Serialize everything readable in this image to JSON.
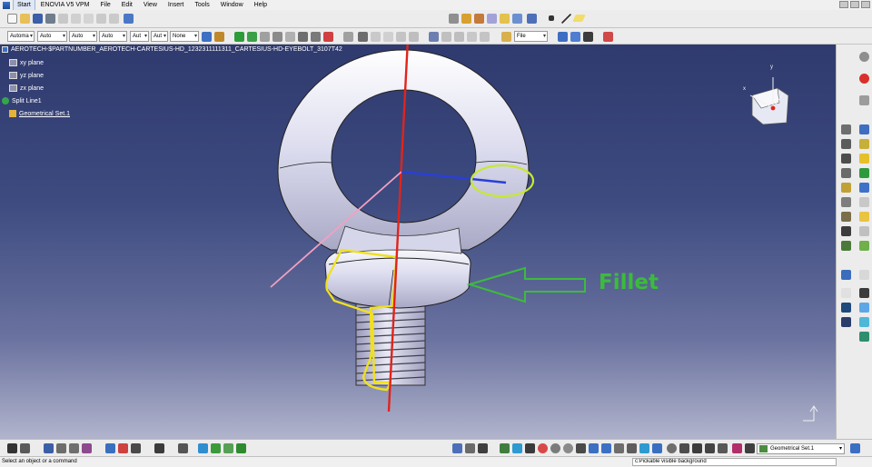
{
  "menubar": {
    "items": [
      "Start",
      "ENOVIA V5 VPM",
      "File",
      "Edit",
      "View",
      "Insert",
      "Tools",
      "Window",
      "Help"
    ]
  },
  "toolbar2": {
    "dropdowns": [
      "Automa",
      "Auto",
      "Auto",
      "Auto",
      "Aut",
      "Aut",
      "None"
    ],
    "file_dropdown": "File"
  },
  "tree": {
    "root": "AEROTECH-$PARTNUMBER_AEROTECH-CARTESIUS-HD_1232311111311_CARTESIUS-HD-EYEBOLT_3107T42",
    "items": [
      "xy plane",
      "yz plane",
      "zx plane",
      "Split Line1",
      "Geometrical Set.1"
    ]
  },
  "annotation": {
    "label": "Fillet",
    "color": "#3cbb3c"
  },
  "compass": {
    "x_label": "x",
    "y_label": "y"
  },
  "bottom": {
    "geo_set": "Geometrical Set.1",
    "status_left": "Select an object or a command",
    "status_input": "c:Pickable visible background"
  },
  "colors": {
    "viewport_top": "#2f3a6e",
    "viewport_bottom": "#b1b4cc",
    "axis_red": "#e0241c",
    "axis_blue": "#2a3fd6",
    "axis_pink": "#f4a0c0",
    "highlight_yellow": "#f0e020",
    "circle_yellowgreen": "#c8e830"
  }
}
